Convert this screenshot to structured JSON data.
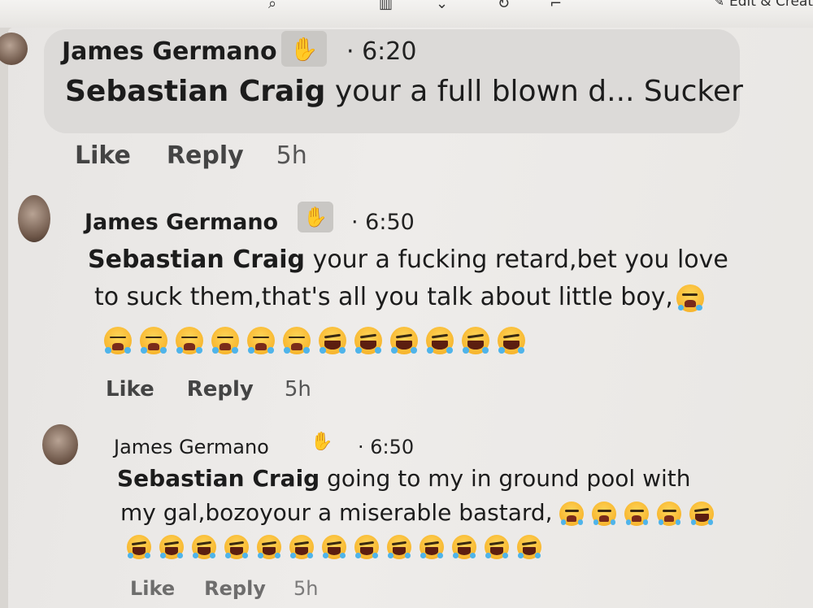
{
  "toolbar": {
    "edit_create_label": "Edit & Creat"
  },
  "comments": [
    {
      "author": "James Germano",
      "time": "6:20",
      "mention": "Sebastian Craig",
      "text_lines": [
        "your a full blown d... Sucker"
      ],
      "actions": {
        "like": "Like",
        "reply": "Reply",
        "age": "5h"
      },
      "emoji_rows": []
    },
    {
      "author": "James Germano",
      "time": "6:50",
      "mention": "Sebastian Craig",
      "text_lines": [
        "your a fucking retard,bet you love",
        "to suck them,that's all you talk about little boy,"
      ],
      "actions": {
        "like": "Like",
        "reply": "Reply",
        "age": "5h"
      },
      "emoji_rows": [
        [
          "sob",
          "sob",
          "sob",
          "sob",
          "sob",
          "sob",
          "laugh",
          "laugh",
          "laugh",
          "laugh",
          "laugh",
          "laugh"
        ]
      ]
    },
    {
      "author": "James Germano",
      "time": "6:50",
      "mention": "Sebastian Craig",
      "text_lines": [
        "going to my in ground pool with",
        "my gal,bozoyour a miserable bastard,"
      ],
      "actions": {
        "like": "Like",
        "reply": "Reply",
        "age": "5h"
      },
      "emoji_rows": [
        [
          "laugh",
          "laugh",
          "laugh",
          "laugh",
          "laugh",
          "laugh",
          "laugh",
          "laugh",
          "laugh",
          "laugh",
          "laugh",
          "laugh",
          "laugh"
        ]
      ]
    }
  ]
}
